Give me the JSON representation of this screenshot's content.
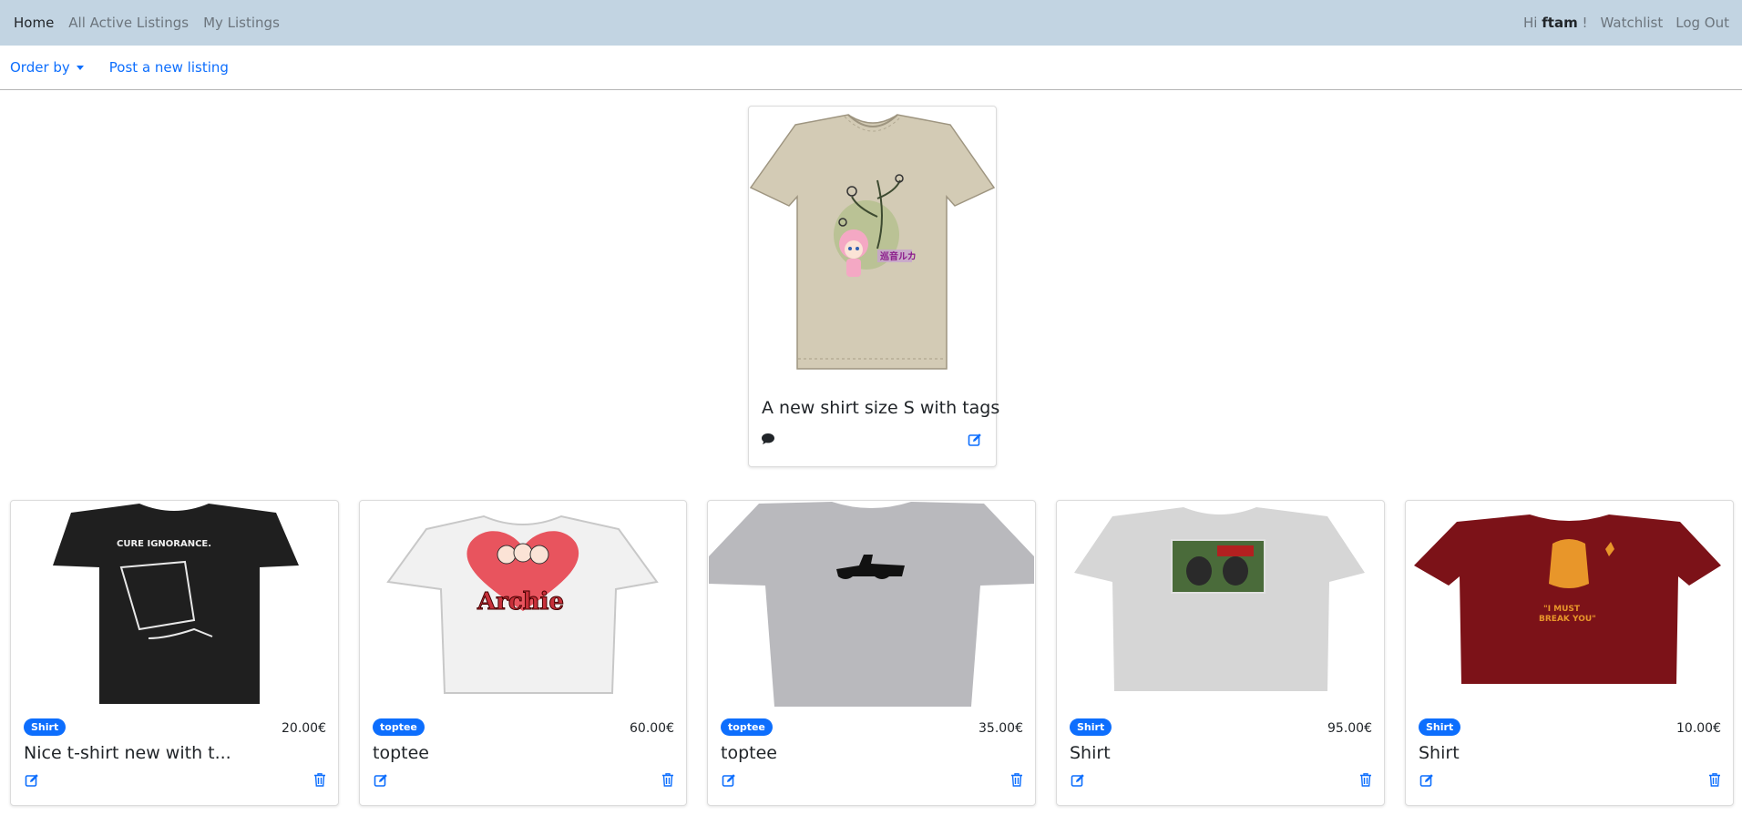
{
  "nav": {
    "home": "Home",
    "all_active": "All Active Listings",
    "my_listings": "My Listings",
    "greeting_prefix": "Hi",
    "username": "ftam",
    "greeting_suffix": "!",
    "watchlist": "Watchlist",
    "logout": "Log Out"
  },
  "subnav": {
    "order_by": "Order by",
    "post_new": "Post a new listing"
  },
  "featured": {
    "title": "A new shirt size S with tags",
    "shirt_color": "#d3cbb5"
  },
  "listings": [
    {
      "category": "Shirt",
      "price": "20.00€",
      "title": "Nice t-shirt new with t...",
      "shirt_color": "#1f1f1f"
    },
    {
      "category": "toptee",
      "price": "60.00€",
      "title": "toptee",
      "shirt_color": "#f1f1f1"
    },
    {
      "category": "toptee",
      "price": "35.00€",
      "title": "toptee",
      "shirt_color": "#b9b9bd"
    },
    {
      "category": "Shirt",
      "price": "95.00€",
      "title": "Shirt",
      "shirt_color": "#d6d6d6"
    },
    {
      "category": "Shirt",
      "price": "10.00€",
      "title": "Shirt",
      "shirt_color": "#7c1218"
    }
  ],
  "colors": {
    "navbar_bg": "#c2d4e2",
    "link": "#0d6efd",
    "badge": "#0d6efd"
  }
}
